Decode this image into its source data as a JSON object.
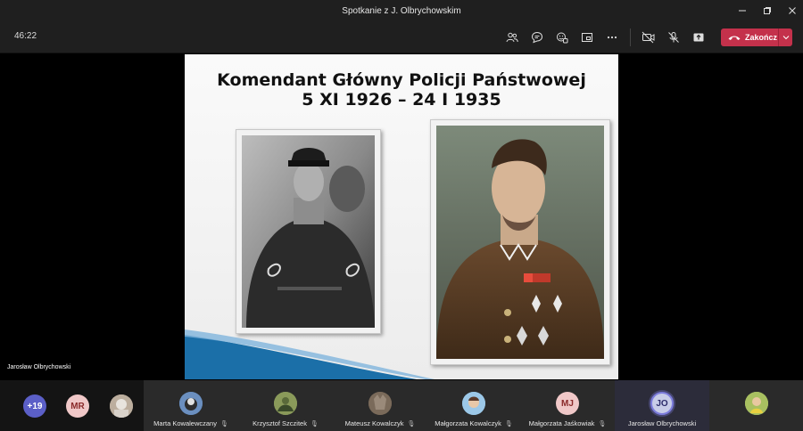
{
  "window": {
    "title": "Spotkanie z J. Olbrychowskim",
    "controls": [
      "minimize-icon",
      "maximize-icon",
      "close-icon"
    ]
  },
  "toolbar": {
    "timer": "46:22",
    "icons": [
      "people-icon",
      "chat-icon",
      "reactions-icon",
      "rooms-icon",
      "more-icon",
      "camera-off-icon",
      "mic-off-icon",
      "share-icon"
    ],
    "leave_label": "Zakończ",
    "leave_color": "#c4314b"
  },
  "slide": {
    "title_line1": "Komendant Główny Policji Państwowej",
    "title_line2": "5 XI 1926 – 24 I 1935",
    "accent_color": "#1b6fa8"
  },
  "stage": {
    "speaker_name": "Jarosław Olbrychowski"
  },
  "participants": {
    "overflow_count": "+19",
    "bubbles": [
      {
        "initials": "MR",
        "color": "#f0c8c8",
        "text_color": "#8a2a2a"
      }
    ],
    "tiles": [
      {
        "name": "Marta Kowalewczany",
        "muted": true
      },
      {
        "name": "Krzysztof Szczitek",
        "muted": true
      },
      {
        "name": "Mateusz Kowalczyk",
        "muted": true
      },
      {
        "name": "Małgorzata Kowalczyk",
        "muted": true
      },
      {
        "name": "Małgorzata Jaśkowiak",
        "initials": "MJ",
        "muted": true
      },
      {
        "name": "Jarosław Olbrychowski",
        "initials": "JO",
        "active": true
      }
    ]
  }
}
